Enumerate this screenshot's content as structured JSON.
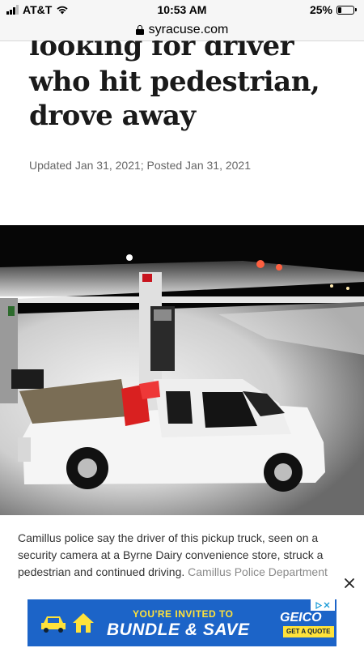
{
  "status_bar": {
    "carrier": "AT&T",
    "time": "10:53 AM",
    "battery_percent": "25%",
    "battery_level": 0.25
  },
  "browser": {
    "url": "syracuse.com"
  },
  "article": {
    "headline_lines": [
      "looking for driver",
      "who hit pedestrian,",
      "drove away"
    ],
    "meta": "Updated Jan 31, 2021; Posted Jan 31, 2021",
    "caption": "Camillus police say the driver of this pickup truck, seen on a security camera at a Byrne Dairy convenience store, struck a pedestrian and continued driving.",
    "credit": "Camillus Police Department"
  },
  "ad": {
    "invite": "YOU'RE INVITED TO",
    "headline": "BUNDLE & SAVE",
    "brand": "GEICO",
    "cta": "GET A QUOTE"
  }
}
